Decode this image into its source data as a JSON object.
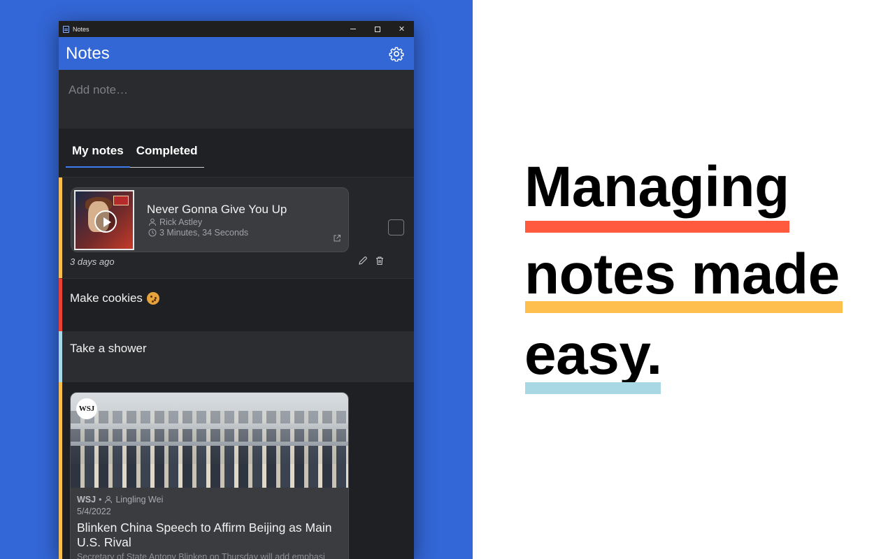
{
  "window": {
    "title": "Notes",
    "controls": {
      "minimize": "minimize",
      "maximize": "maximize",
      "close": "close"
    }
  },
  "appbar": {
    "title": "Notes",
    "settings_icon": "gear-icon"
  },
  "add_note": {
    "placeholder": "Add note…",
    "value": ""
  },
  "tabs": [
    {
      "label": "My notes",
      "active": true
    },
    {
      "label": "Completed",
      "active": false
    }
  ],
  "notes": [
    {
      "type": "media",
      "color": "#f6bf4f",
      "title": "Never Gonna Give You Up",
      "artist": "Rick Astley",
      "duration": "3 Minutes, 34 Seconds",
      "timestamp": "3 days ago",
      "completed": false
    },
    {
      "type": "text",
      "color": "#e94235",
      "text": "Make cookies"
    },
    {
      "type": "text",
      "color": "#a8d8e8",
      "text": "Take a shower"
    },
    {
      "type": "article",
      "color": "#f6bf4f",
      "source_badge": "WSJ",
      "source": "WSJ",
      "author": "Lingling Wei",
      "date": "5/4/2022",
      "title": "Blinken China Speech to Affirm Beijing as Main U.S. Rival",
      "description": "Secretary of State Antony Blinken on Thursday will add emphasi"
    }
  ],
  "headline": {
    "lines": [
      "Managing",
      "notes made",
      "easy."
    ],
    "underline_colors": [
      "#ff5a3d",
      "#ffbf4f",
      "#a8d8e4"
    ]
  },
  "colors": {
    "background_left": "#3366d6",
    "accent": "#3367d6",
    "window_bg": "#202124"
  }
}
